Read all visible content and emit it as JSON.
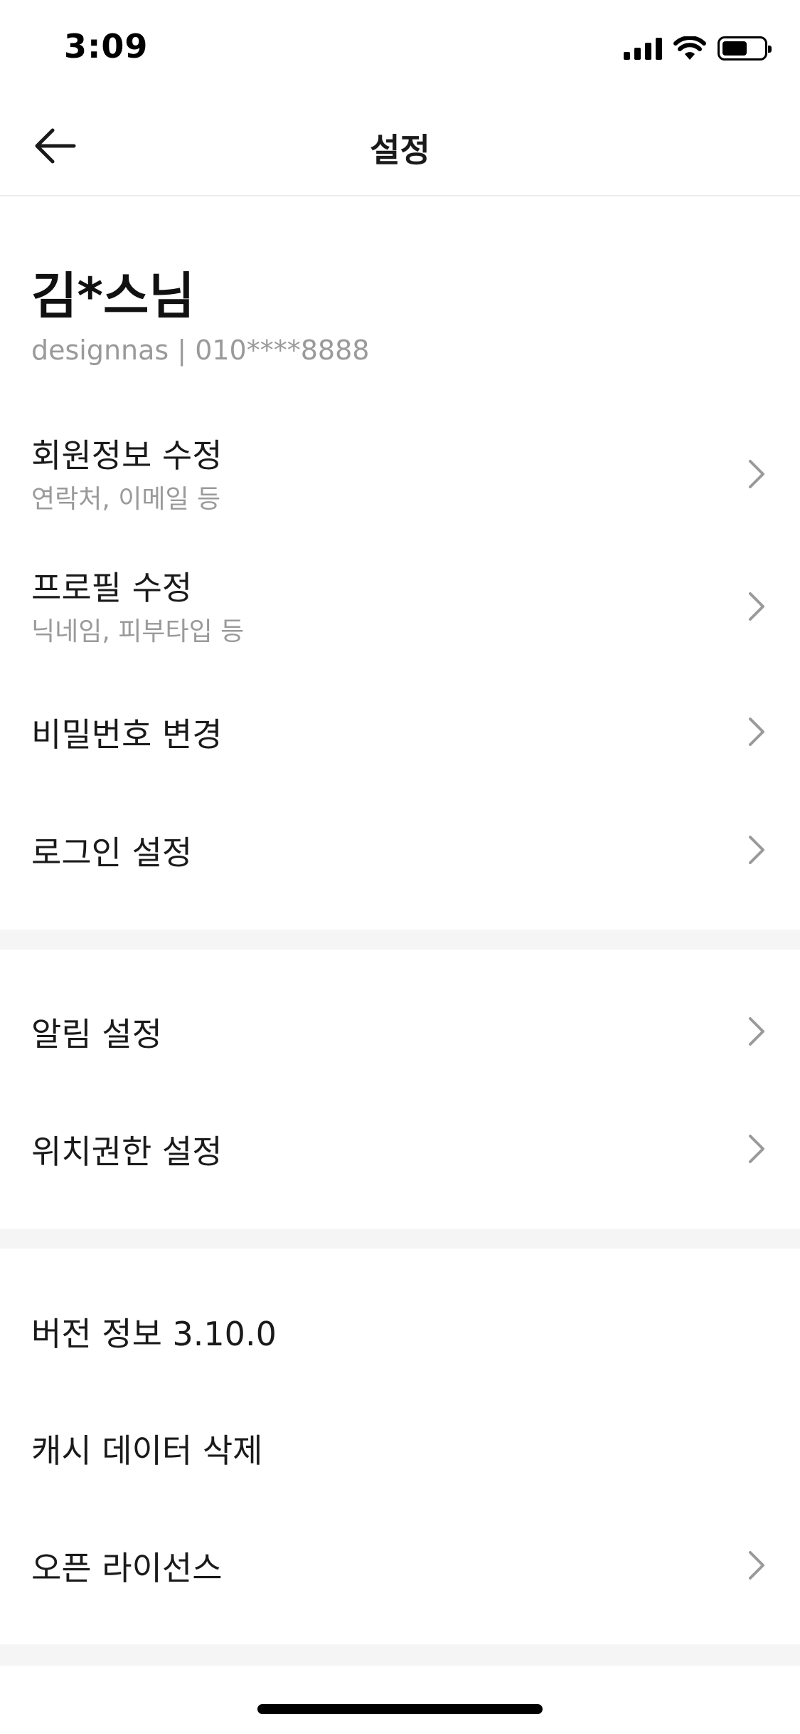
{
  "status_bar": {
    "time": "3:09"
  },
  "nav": {
    "title": "설정"
  },
  "profile": {
    "name": "김*스님",
    "detail": "designnas | 010****8888"
  },
  "menu": {
    "member_info": {
      "title": "회원정보 수정",
      "subtitle": "연락처, 이메일 등"
    },
    "profile_edit": {
      "title": "프로필 수정",
      "subtitle": "닉네임, 피부타입 등"
    },
    "password": {
      "title": "비밀번호 변경"
    },
    "login": {
      "title": "로그인 설정"
    },
    "notification": {
      "title": "알림 설정"
    },
    "location": {
      "title": "위치권한 설정"
    },
    "version": {
      "title": "버전 정보 3.10.0"
    },
    "cache": {
      "title": "캐시 데이터 삭제"
    },
    "license": {
      "title": "오픈 라이선스"
    }
  },
  "icons": {
    "back": "arrow-left-icon",
    "chevron": "chevron-right-icon",
    "signal": "cellular-signal-icon",
    "wifi": "wifi-icon",
    "battery": "battery-icon"
  },
  "colors": {
    "text_primary": "#1a1a1a",
    "text_secondary": "#9a9a9a",
    "section_gap": "#f5f5f6",
    "chevron": "#9a9a9a"
  }
}
